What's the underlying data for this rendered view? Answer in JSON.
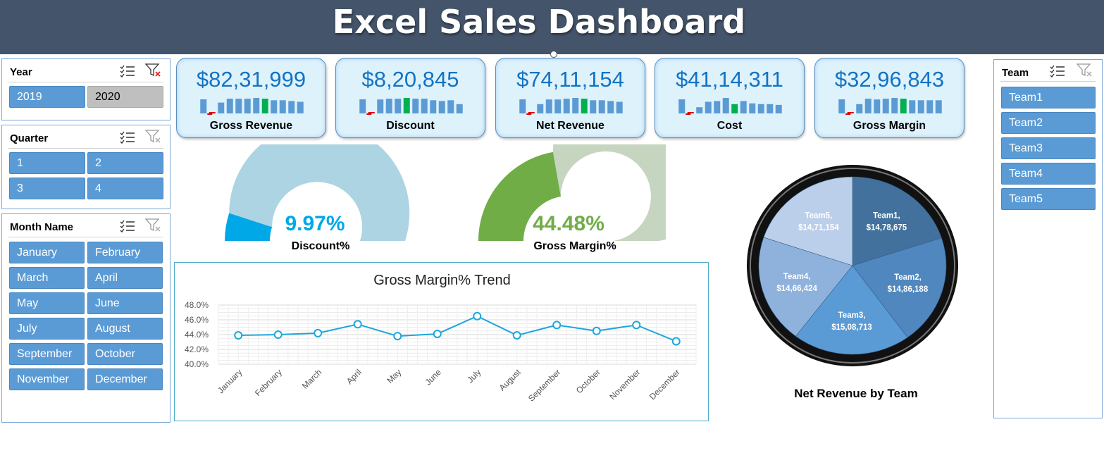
{
  "header": {
    "title": "Excel Sales Dashboard"
  },
  "slicers": {
    "year": {
      "title": "Year",
      "items": [
        "2019",
        "2020"
      ]
    },
    "quarter": {
      "title": "Quarter",
      "items": [
        "1",
        "2",
        "3",
        "4"
      ]
    },
    "month": {
      "title": "Month Name",
      "items": [
        "January",
        "February",
        "March",
        "April",
        "May",
        "June",
        "July",
        "August",
        "September",
        "October",
        "November",
        "December"
      ]
    },
    "team": {
      "title": "Team",
      "items": [
        "Team1",
        "Team2",
        "Team3",
        "Team4",
        "Team5"
      ]
    }
  },
  "kpis": [
    {
      "value": "$82,31,999",
      "label": "Gross Revenue"
    },
    {
      "value": "$8,20,845",
      "label": "Discount"
    },
    {
      "value": "$74,11,154",
      "label": "Net Revenue"
    },
    {
      "value": "$41,14,311",
      "label": "Cost"
    },
    {
      "value": "$32,96,843",
      "label": "Gross Margin"
    }
  ],
  "gauges": {
    "discount": {
      "value": "9.97%",
      "label": "Discount%",
      "fraction": 0.0997,
      "color": "#00a8e8",
      "track": "#add4e3"
    },
    "margin": {
      "value": "44.48%",
      "label": "Gross Margin%",
      "fraction": 0.4448,
      "color": "#70ad47",
      "track": "#c5d5bf"
    }
  },
  "chart_data": [
    {
      "type": "line",
      "title": "Gross Margin% Trend",
      "categories": [
        "January",
        "February",
        "March",
        "April",
        "May",
        "June",
        "July",
        "August",
        "September",
        "October",
        "November",
        "December"
      ],
      "values": [
        43.9,
        44.0,
        44.2,
        45.4,
        43.8,
        44.1,
        46.5,
        43.9,
        45.3,
        44.5,
        45.3,
        43.1
      ],
      "yticks": [
        "48.0%",
        "46.0%",
        "44.0%",
        "42.0%",
        "40.0%"
      ],
      "ylim": [
        40,
        48
      ],
      "color": "#1aa7dc"
    },
    {
      "type": "pie",
      "title": "Net Revenue by Team",
      "slices": [
        {
          "name": "Team1",
          "label": "$14,78,675",
          "value": 1478675,
          "color": "#41719c"
        },
        {
          "name": "Team2",
          "label": "$14,86,188",
          "value": 1486188,
          "color": "#4f87be"
        },
        {
          "name": "Team3",
          "label": "$15,08,713",
          "value": 1508713,
          "color": "#5b9bd5"
        },
        {
          "name": "Team4",
          "label": "$14,66,424",
          "value": 1466424,
          "color": "#8fb2dd"
        },
        {
          "name": "Team5",
          "label": "$14,71,154",
          "value": 1471154,
          "color": "#bccfea"
        }
      ]
    }
  ],
  "sparkline_colors": {
    "bar": "#5b9bd5",
    "high": "#00b050",
    "low": "#e00000"
  },
  "sparklines": [
    [
      0.25,
      1.0,
      0.7,
      0.95,
      0.95,
      0.95,
      1.0,
      0.95,
      0.85,
      0.85,
      0.8,
      0.75
    ],
    [
      0.25,
      1.0,
      0.9,
      0.95,
      0.95,
      1.0,
      0.95,
      0.95,
      0.85,
      0.8,
      0.85,
      0.6
    ],
    [
      0.25,
      1.0,
      0.6,
      0.9,
      0.9,
      0.95,
      1.0,
      0.95,
      0.85,
      0.85,
      0.8,
      0.75
    ],
    [
      0.25,
      0.85,
      0.4,
      0.75,
      0.8,
      1.0,
      0.6,
      0.8,
      0.65,
      0.6,
      0.6,
      0.55
    ],
    [
      0.25,
      1.0,
      0.6,
      0.95,
      0.9,
      0.95,
      1.0,
      0.95,
      0.85,
      0.85,
      0.85,
      0.85
    ]
  ],
  "sparkline_highlight": [
    {
      "low": 1,
      "high": 7
    },
    {
      "low": 1,
      "high": 5
    },
    {
      "low": 1,
      "high": 7
    },
    {
      "low": 1,
      "high": 6
    },
    {
      "low": 1,
      "high": 7
    }
  ]
}
